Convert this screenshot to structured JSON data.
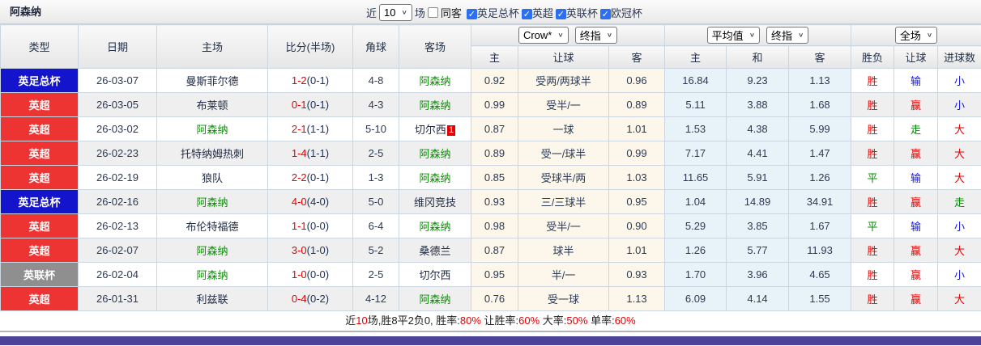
{
  "header_bar": {
    "title": "阿森纳",
    "recent_label": "近",
    "matches_count": "10",
    "matches_label": "场",
    "same_away_filter": {
      "label": "同客",
      "checked": false
    },
    "league_filters": [
      {
        "label": "英足总杯",
        "checked": true
      },
      {
        "label": "英超",
        "checked": true
      },
      {
        "label": "英联杯",
        "checked": true
      },
      {
        "label": "欧冠杯",
        "checked": true
      }
    ]
  },
  "table": {
    "main_headers": [
      "类型",
      "日期",
      "主场",
      "比分(半场)",
      "角球",
      "客场"
    ],
    "sub_headers": [
      "主",
      "让球",
      "客",
      "主",
      "和",
      "客",
      "胜负",
      "让球",
      "进球数"
    ],
    "selects": {
      "odds_source": "Crow*",
      "odds_time": "终指",
      "avg_source": "平均值",
      "avg_time": "终指",
      "scope": "全场"
    },
    "rows": [
      {
        "type": "英足总杯",
        "type_color": "blue",
        "date": "26-03-07",
        "home": {
          "name": "曼斯菲尔德",
          "green": false,
          "red_card": ""
        },
        "score_full": "1-2",
        "score_half": "(0-1)",
        "corner": "4-8",
        "away": {
          "name": "阿森纳",
          "green": true,
          "red_card": ""
        },
        "crow": {
          "home": "0.92",
          "handicap": "受两/两球半",
          "away": "0.96"
        },
        "avg": {
          "home": "16.84",
          "draw": "9.23",
          "away": "1.13"
        },
        "result": {
          "outcome": {
            "text": "胜",
            "color": "red"
          },
          "handicap": {
            "text": "输",
            "color": "blue"
          },
          "goals": {
            "text": "小",
            "color": "blue"
          }
        }
      },
      {
        "type": "英超",
        "type_color": "red",
        "date": "26-03-05",
        "home": {
          "name": "布莱顿",
          "green": false,
          "red_card": ""
        },
        "score_full": "0-1",
        "score_half": "(0-1)",
        "corner": "4-3",
        "away": {
          "name": "阿森纳",
          "green": true,
          "red_card": ""
        },
        "crow": {
          "home": "0.99",
          "handicap": "受半/一",
          "away": "0.89"
        },
        "avg": {
          "home": "5.11",
          "draw": "3.88",
          "away": "1.68"
        },
        "result": {
          "outcome": {
            "text": "胜",
            "color": "red"
          },
          "handicap": {
            "text": "赢",
            "color": "red"
          },
          "goals": {
            "text": "小",
            "color": "blue"
          }
        }
      },
      {
        "type": "英超",
        "type_color": "red",
        "date": "26-03-02",
        "home": {
          "name": "阿森纳",
          "green": true,
          "red_card": ""
        },
        "score_full": "2-1",
        "score_half": "(1-1)",
        "corner": "5-10",
        "away": {
          "name": "切尔西",
          "green": false,
          "red_card": "1"
        },
        "crow": {
          "home": "0.87",
          "handicap": "一球",
          "away": "1.01"
        },
        "avg": {
          "home": "1.53",
          "draw": "4.38",
          "away": "5.99"
        },
        "result": {
          "outcome": {
            "text": "胜",
            "color": "red"
          },
          "handicap": {
            "text": "走",
            "color": "green"
          },
          "goals": {
            "text": "大",
            "color": "red"
          }
        }
      },
      {
        "type": "英超",
        "type_color": "red",
        "date": "26-02-23",
        "home": {
          "name": "托特纳姆热刺",
          "green": false,
          "red_card": ""
        },
        "score_full": "1-4",
        "score_half": "(1-1)",
        "corner": "2-5",
        "away": {
          "name": "阿森纳",
          "green": true,
          "red_card": ""
        },
        "crow": {
          "home": "0.89",
          "handicap": "受一/球半",
          "away": "0.99"
        },
        "avg": {
          "home": "7.17",
          "draw": "4.41",
          "away": "1.47"
        },
        "result": {
          "outcome": {
            "text": "胜",
            "color": "red"
          },
          "handicap": {
            "text": "赢",
            "color": "red"
          },
          "goals": {
            "text": "大",
            "color": "red"
          }
        }
      },
      {
        "type": "英超",
        "type_color": "red",
        "date": "26-02-19",
        "home": {
          "name": "狼队",
          "green": false,
          "red_card": ""
        },
        "score_full": "2-2",
        "score_half": "(0-1)",
        "corner": "1-3",
        "away": {
          "name": "阿森纳",
          "green": true,
          "red_card": ""
        },
        "crow": {
          "home": "0.85",
          "handicap": "受球半/两",
          "away": "1.03"
        },
        "avg": {
          "home": "11.65",
          "draw": "5.91",
          "away": "1.26"
        },
        "result": {
          "outcome": {
            "text": "平",
            "color": "green"
          },
          "handicap": {
            "text": "输",
            "color": "blue"
          },
          "goals": {
            "text": "大",
            "color": "red"
          }
        }
      },
      {
        "type": "英足总杯",
        "type_color": "blue",
        "date": "26-02-16",
        "home": {
          "name": "阿森纳",
          "green": true,
          "red_card": ""
        },
        "score_full": "4-0",
        "score_half": "(4-0)",
        "corner": "5-0",
        "away": {
          "name": "维冈竞技",
          "green": false,
          "red_card": ""
        },
        "crow": {
          "home": "0.93",
          "handicap": "三/三球半",
          "away": "0.95"
        },
        "avg": {
          "home": "1.04",
          "draw": "14.89",
          "away": "34.91"
        },
        "result": {
          "outcome": {
            "text": "胜",
            "color": "red"
          },
          "handicap": {
            "text": "赢",
            "color": "red"
          },
          "goals": {
            "text": "走",
            "color": "green"
          }
        }
      },
      {
        "type": "英超",
        "type_color": "red",
        "date": "26-02-13",
        "home": {
          "name": "布伦特福德",
          "green": false,
          "red_card": ""
        },
        "score_full": "1-1",
        "score_half": "(0-0)",
        "corner": "6-4",
        "away": {
          "name": "阿森纳",
          "green": true,
          "red_card": ""
        },
        "crow": {
          "home": "0.98",
          "handicap": "受半/一",
          "away": "0.90"
        },
        "avg": {
          "home": "5.29",
          "draw": "3.85",
          "away": "1.67"
        },
        "result": {
          "outcome": {
            "text": "平",
            "color": "green"
          },
          "handicap": {
            "text": "输",
            "color": "blue"
          },
          "goals": {
            "text": "小",
            "color": "blue"
          }
        }
      },
      {
        "type": "英超",
        "type_color": "red",
        "date": "26-02-07",
        "home": {
          "name": "阿森纳",
          "green": true,
          "red_card": ""
        },
        "score_full": "3-0",
        "score_half": "(1-0)",
        "corner": "5-2",
        "away": {
          "name": "桑德兰",
          "green": false,
          "red_card": ""
        },
        "crow": {
          "home": "0.87",
          "handicap": "球半",
          "away": "1.01"
        },
        "avg": {
          "home": "1.26",
          "draw": "5.77",
          "away": "11.93"
        },
        "result": {
          "outcome": {
            "text": "胜",
            "color": "red"
          },
          "handicap": {
            "text": "赢",
            "color": "red"
          },
          "goals": {
            "text": "大",
            "color": "red"
          }
        }
      },
      {
        "type": "英联杯",
        "type_color": "gray",
        "date": "26-02-04",
        "home": {
          "name": "阿森纳",
          "green": true,
          "red_card": ""
        },
        "score_full": "1-0",
        "score_half": "(0-0)",
        "corner": "2-5",
        "away": {
          "name": "切尔西",
          "green": false,
          "red_card": ""
        },
        "crow": {
          "home": "0.95",
          "handicap": "半/一",
          "away": "0.93"
        },
        "avg": {
          "home": "1.70",
          "draw": "3.96",
          "away": "4.65"
        },
        "result": {
          "outcome": {
            "text": "胜",
            "color": "red"
          },
          "handicap": {
            "text": "赢",
            "color": "red"
          },
          "goals": {
            "text": "小",
            "color": "blue"
          }
        }
      },
      {
        "type": "英超",
        "type_color": "red",
        "date": "26-01-31",
        "home": {
          "name": "利兹联",
          "green": false,
          "red_card": ""
        },
        "score_full": "0-4",
        "score_half": "(0-2)",
        "corner": "4-12",
        "away": {
          "name": "阿森纳",
          "green": true,
          "red_card": ""
        },
        "crow": {
          "home": "0.76",
          "handicap": "受一球",
          "away": "1.13"
        },
        "avg": {
          "home": "6.09",
          "draw": "4.14",
          "away": "1.55"
        },
        "result": {
          "outcome": {
            "text": "胜",
            "color": "red"
          },
          "handicap": {
            "text": "赢",
            "color": "red"
          },
          "goals": {
            "text": "大",
            "color": "red"
          }
        }
      }
    ]
  },
  "summary": {
    "segments": [
      {
        "text": "近",
        "color": "dark"
      },
      {
        "text": "10",
        "color": "red"
      },
      {
        "text": "场,胜8平2负0, 胜率:",
        "color": "dark"
      },
      {
        "text": "80%",
        "color": "red"
      },
      {
        "text": " 让胜率:",
        "color": "dark"
      },
      {
        "text": "60%",
        "color": "red"
      },
      {
        "text": " 大率:",
        "color": "dark"
      },
      {
        "text": "50%",
        "color": "red"
      },
      {
        "text": " 单率:",
        "color": "dark"
      },
      {
        "text": "60%",
        "color": "red"
      }
    ]
  },
  "colors": {
    "league_blue": "#1414cc",
    "league_red": "#ee3333",
    "league_gray": "#8f8f8f",
    "team_green": "#089000",
    "win_red": "#e60000",
    "draw_green": "#008800",
    "lose_blue": "#1515dd",
    "footer_bar": "#4c4398",
    "crow_column_bg": "#fcf7ea",
    "avg_column_bg": "#e8f3f9"
  }
}
